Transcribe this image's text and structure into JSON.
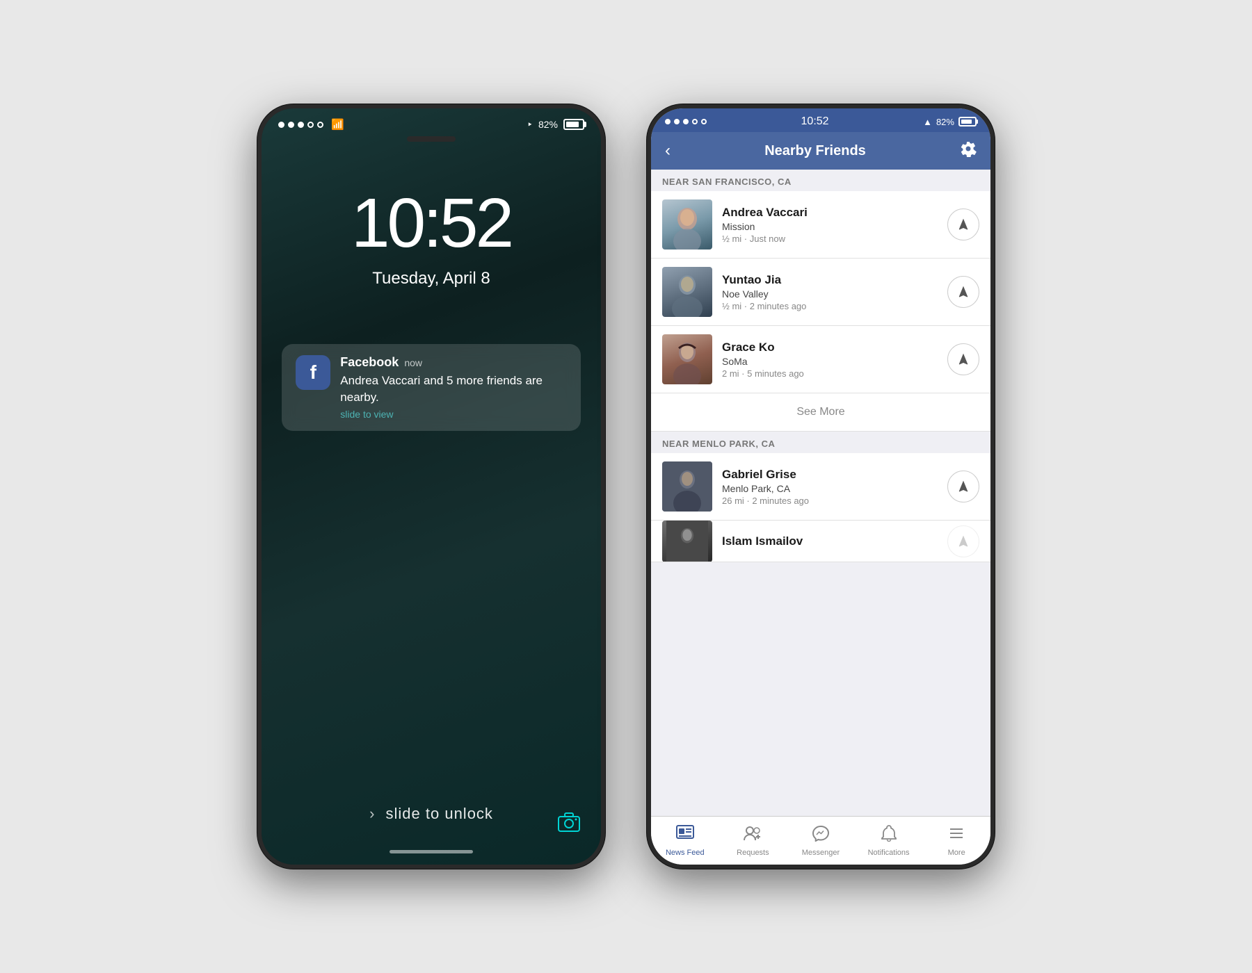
{
  "lockScreen": {
    "statusBar": {
      "signalDots": [
        true,
        true,
        true,
        false,
        false
      ],
      "wifi": "wifi",
      "batteryPercent": "82%",
      "locationArrow": "▲"
    },
    "time": "10:52",
    "date": "Tuesday, April 8",
    "notification": {
      "appName": "Facebook",
      "timeAgo": "now",
      "body": "Andrea Vaccari and 5 more friends are nearby.",
      "slideToView": "slide to view"
    },
    "slideToUnlock": "slide to unlock",
    "speaker": ""
  },
  "appScreen": {
    "statusBar": {
      "signalDots": [
        true,
        true,
        true,
        false,
        false
      ],
      "time": "10:52",
      "batteryPercent": "82%"
    },
    "navbar": {
      "backLabel": "‹",
      "title": "Nearby Friends",
      "gearIcon": "⚙"
    },
    "sections": [
      {
        "id": "sf",
        "header": "NEAR SAN FRANCISCO, CA",
        "friends": [
          {
            "name": "Andrea Vaccari",
            "location": "Mission",
            "distance": "½ mi · Just now",
            "avatarClass": "face-andrea"
          },
          {
            "name": "Yuntao Jia",
            "location": "Noe Valley",
            "distance": "½ mi · 2 minutes ago",
            "avatarClass": "face-yuntao"
          },
          {
            "name": "Grace Ko",
            "location": "SoMa",
            "distance": "2 mi · 5 minutes ago",
            "avatarClass": "face-grace"
          }
        ]
      },
      {
        "id": "menlo",
        "header": "NEAR MENLO PARK, CA",
        "friends": [
          {
            "name": "Gabriel Grise",
            "location": "Menlo Park, CA",
            "distance": "26 mi · 2 minutes ago",
            "avatarClass": "face-gabriel"
          },
          {
            "name": "Islam Ismailov",
            "location": "",
            "distance": "",
            "avatarClass": "face-islam"
          }
        ]
      }
    ],
    "seeMore": "See More",
    "tabBar": {
      "tabs": [
        {
          "id": "newsfeed",
          "label": "News Feed",
          "icon": "newsfeed",
          "active": true
        },
        {
          "id": "requests",
          "label": "Requests",
          "icon": "requests",
          "active": false
        },
        {
          "id": "messenger",
          "label": "Messenger",
          "icon": "messenger",
          "active": false
        },
        {
          "id": "notifications",
          "label": "Notifications",
          "icon": "notifications",
          "active": false
        },
        {
          "id": "more",
          "label": "More",
          "icon": "more",
          "active": false
        }
      ]
    }
  }
}
